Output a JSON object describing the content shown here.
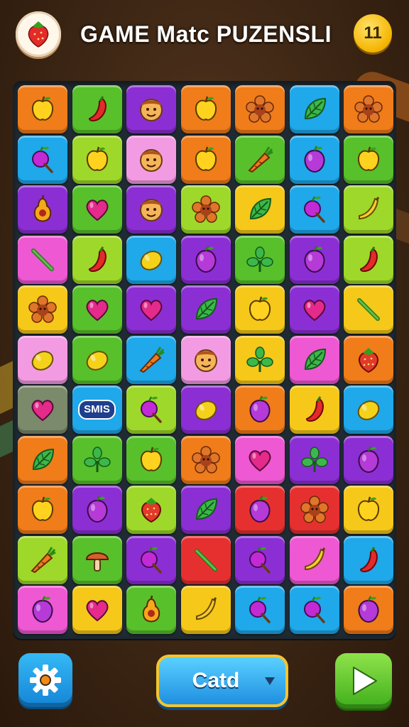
{
  "header": {
    "title": "GAME Matc PUZENSLI",
    "level": "11",
    "logo_icon": "strawberry-icon"
  },
  "colors": {
    "yellow": "#f5c81a",
    "green": "#58c02a",
    "purple": "#8b2fd4",
    "orange": "#f07c1a",
    "blue": "#1fa8ea",
    "pink": "#ee58d2",
    "lightpink": "#f39be2",
    "lime": "#9ed82a",
    "red": "#e63030",
    "gray": "#7b8a6a"
  },
  "board": {
    "rows": [
      [
        {
          "c": "orange",
          "i": "apple"
        },
        {
          "c": "green",
          "i": "chili"
        },
        {
          "c": "purple",
          "i": "face"
        },
        {
          "c": "orange",
          "i": "apple"
        },
        {
          "c": "orange",
          "i": "flower"
        },
        {
          "c": "blue",
          "i": "leaf"
        },
        {
          "c": "orange",
          "i": "flower"
        }
      ],
      [
        {
          "c": "blue",
          "i": "cherry"
        },
        {
          "c": "lime",
          "i": "apple"
        },
        {
          "c": "lightpink",
          "i": "face"
        },
        {
          "c": "orange",
          "i": "apple"
        },
        {
          "c": "green",
          "i": "carrot"
        },
        {
          "c": "blue",
          "i": "plum"
        },
        {
          "c": "green",
          "i": "apple"
        }
      ],
      [
        {
          "c": "purple",
          "i": "pear"
        },
        {
          "c": "green",
          "i": "heart"
        },
        {
          "c": "purple",
          "i": "face"
        },
        {
          "c": "lime",
          "i": "flower"
        },
        {
          "c": "yellow",
          "i": "leaf"
        },
        {
          "c": "blue",
          "i": "cherry"
        },
        {
          "c": "lime",
          "i": "banana"
        }
      ],
      [
        {
          "c": "pink",
          "i": "stick"
        },
        {
          "c": "lime",
          "i": "chili"
        },
        {
          "c": "blue",
          "i": "lemon"
        },
        {
          "c": "purple",
          "i": "plum"
        },
        {
          "c": "green",
          "i": "clover"
        },
        {
          "c": "purple",
          "i": "plum"
        },
        {
          "c": "lime",
          "i": "chili"
        }
      ],
      [
        {
          "c": "yellow",
          "i": "flower"
        },
        {
          "c": "green",
          "i": "heart"
        },
        {
          "c": "purple",
          "i": "heart"
        },
        {
          "c": "purple",
          "i": "leaf"
        },
        {
          "c": "yellow",
          "i": "apple"
        },
        {
          "c": "purple",
          "i": "heart"
        },
        {
          "c": "yellow",
          "i": "stick"
        }
      ],
      [
        {
          "c": "lightpink",
          "i": "lemon"
        },
        {
          "c": "green",
          "i": "lemon"
        },
        {
          "c": "blue",
          "i": "carrot"
        },
        {
          "c": "lightpink",
          "i": "face"
        },
        {
          "c": "yellow",
          "i": "clover"
        },
        {
          "c": "pink",
          "i": "leaf"
        },
        {
          "c": "orange",
          "i": "berry"
        }
      ],
      [
        {
          "c": "gray",
          "i": "heart"
        },
        {
          "c": "blue",
          "i": "badge",
          "t": "SMIS"
        },
        {
          "c": "lime",
          "i": "cherry"
        },
        {
          "c": "purple",
          "i": "lemon"
        },
        {
          "c": "orange",
          "i": "plum"
        },
        {
          "c": "yellow",
          "i": "chili"
        },
        {
          "c": "blue",
          "i": "lemon"
        }
      ],
      [
        {
          "c": "orange",
          "i": "leaf"
        },
        {
          "c": "green",
          "i": "clover"
        },
        {
          "c": "green",
          "i": "apple"
        },
        {
          "c": "orange",
          "i": "flower"
        },
        {
          "c": "pink",
          "i": "heart"
        },
        {
          "c": "purple",
          "i": "clover"
        },
        {
          "c": "purple",
          "i": "plum"
        }
      ],
      [
        {
          "c": "orange",
          "i": "apple"
        },
        {
          "c": "purple",
          "i": "plum"
        },
        {
          "c": "lime",
          "i": "berry"
        },
        {
          "c": "purple",
          "i": "leaf"
        },
        {
          "c": "red",
          "i": "plum"
        },
        {
          "c": "red",
          "i": "flower"
        },
        {
          "c": "yellow",
          "i": "apple"
        }
      ],
      [
        {
          "c": "lime",
          "i": "carrot"
        },
        {
          "c": "green",
          "i": "mushroom"
        },
        {
          "c": "purple",
          "i": "cherry"
        },
        {
          "c": "red",
          "i": "stick"
        },
        {
          "c": "purple",
          "i": "cherry"
        },
        {
          "c": "pink",
          "i": "banana"
        },
        {
          "c": "blue",
          "i": "chili"
        }
      ],
      [
        {
          "c": "pink",
          "i": "plum"
        },
        {
          "c": "yellow",
          "i": "heart"
        },
        {
          "c": "green",
          "i": "pear"
        },
        {
          "c": "yellow",
          "i": "banana"
        },
        {
          "c": "blue",
          "i": "cherry"
        },
        {
          "c": "blue",
          "i": "cherry"
        },
        {
          "c": "orange",
          "i": "plum"
        }
      ]
    ]
  },
  "footer": {
    "settings_icon": "gear-icon",
    "select_label": "Catd",
    "select_icon": "chevron-down-icon",
    "play_icon": "play-icon"
  }
}
